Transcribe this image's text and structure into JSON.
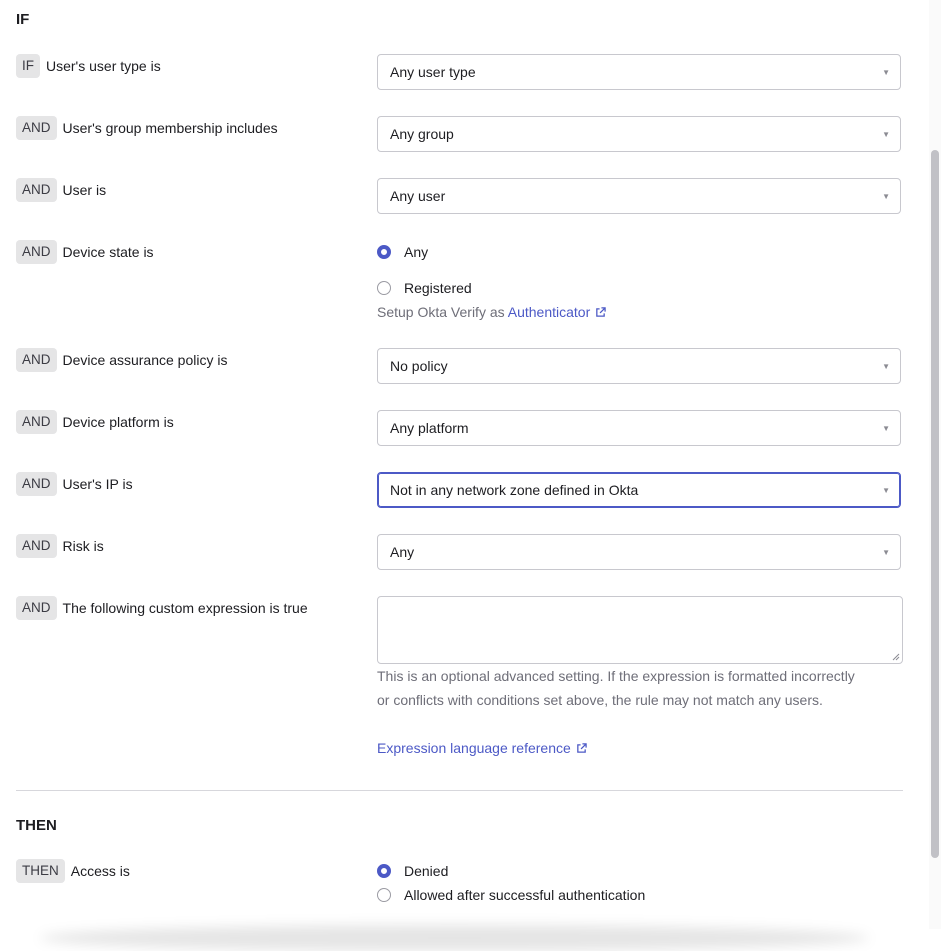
{
  "if_section": {
    "title": "IF"
  },
  "then_section": {
    "title": "THEN"
  },
  "conditions": {
    "user_type": {
      "chip": "IF",
      "label": "User's user type is",
      "value": "Any user type"
    },
    "group": {
      "chip": "AND",
      "label": "User's group membership includes",
      "value": "Any group"
    },
    "user": {
      "chip": "AND",
      "label": "User is",
      "value": "Any user"
    },
    "device_state": {
      "chip": "AND",
      "label": "Device state is",
      "options": [
        "Any",
        "Registered"
      ],
      "selected": "Any",
      "hint_prefix": "Setup Okta Verify as",
      "hint_link": "Authenticator"
    },
    "assurance": {
      "chip": "AND",
      "label": "Device assurance policy is",
      "value": "No policy"
    },
    "platform": {
      "chip": "AND",
      "label": "Device platform is",
      "value": "Any platform"
    },
    "ip": {
      "chip": "AND",
      "label": "User's IP is",
      "value": "Not in any network zone defined in Okta"
    },
    "risk": {
      "chip": "AND",
      "label": "Risk is",
      "value": "Any"
    },
    "expression": {
      "chip": "AND",
      "label": "The following custom expression is true",
      "value": "",
      "help_line1": "This is an optional advanced setting. If the expression is formatted incorrectly",
      "help_line2": "or conflicts with conditions set above, the rule may not match any users.",
      "reference_link": "Expression language reference"
    }
  },
  "access": {
    "chip": "THEN",
    "label": "Access is",
    "options": [
      "Denied",
      "Allowed after successful authentication"
    ],
    "selected": "Denied"
  },
  "colors": {
    "accent": "#4c59c6",
    "chip_bg": "#e5e5e6",
    "border": "#c8c8ce",
    "muted_text": "#6e6e78"
  },
  "icons": {
    "caret": "caret-down-icon",
    "external": "external-link-icon"
  }
}
